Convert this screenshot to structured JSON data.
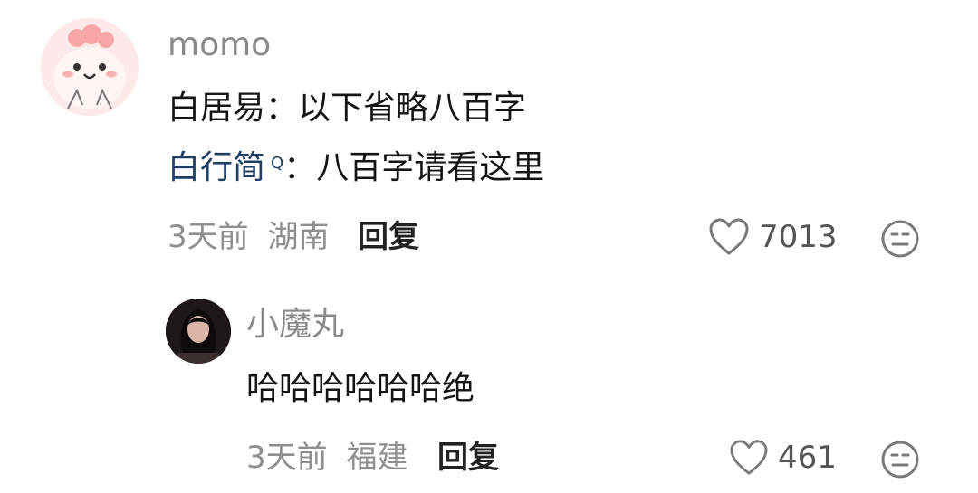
{
  "comments": [
    {
      "username": "momo",
      "text_line1": "白居易：以下省略八百字",
      "reply_ref": {
        "name": "白行简",
        "sup": "Q",
        "text": "：八百字请看这里"
      },
      "time": "3天前",
      "location": "湖南",
      "reply_label": "回复",
      "like_count": "7013"
    },
    {
      "username": "小魔丸",
      "text": "哈哈哈哈哈哈绝",
      "time": "3天前",
      "location": "福建",
      "reply_label": "回复",
      "like_count": "461"
    }
  ],
  "icons": {
    "like": "heart-outline-icon",
    "dislike": "meh-face-icon"
  },
  "colors": {
    "username": "#8a8a8a",
    "link": "#1f3f66",
    "meta": "#8f8f8f",
    "text": "#151515"
  }
}
